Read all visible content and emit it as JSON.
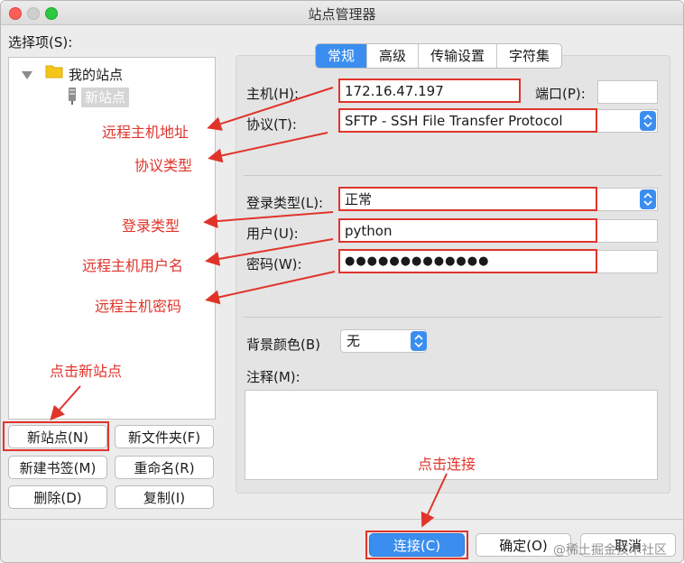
{
  "window": {
    "title": "站点管理器"
  },
  "colors": {
    "accent": "#3b8ef0",
    "annotation": "#e0342b",
    "close": "#fc5f57",
    "minimize": "#c9c9c9",
    "maximize": "#2bc840"
  },
  "left": {
    "heading": "选择项(S):",
    "tree": {
      "folder_label": "我的站点",
      "site_label": "新站点"
    },
    "buttons": {
      "new_site": "新站点(N)",
      "new_folder": "新文件夹(F)",
      "new_bookmark": "新建书签(M)",
      "rename": "重命名(R)",
      "delete": "删除(D)",
      "copy": "复制(I)"
    }
  },
  "tabs": [
    "常规",
    "高级",
    "传输设置",
    "字符集"
  ],
  "form": {
    "host_label": "主机(H):",
    "host_value": "172.16.47.197",
    "port_label": "端口(P):",
    "port_value": "",
    "protocol_label": "协议(T):",
    "protocol_value": "SFTP - SSH File Transfer Protocol",
    "logon_label": "登录类型(L):",
    "logon_value": "正常",
    "user_label": "用户(U):",
    "user_value": "python",
    "password_label": "密码(W):",
    "password_value": "●●●●●●●●●●●●●",
    "bg_label": "背景颜色(B)",
    "bg_value": "无",
    "comment_label": "注释(M):",
    "comment_value": ""
  },
  "annotations": {
    "host": "远程主机地址",
    "protocol": "协议类型",
    "logon": "登录类型",
    "user": "远程主机用户名",
    "password": "远程主机密码",
    "new_site": "点击新站点",
    "connect": "点击连接"
  },
  "footer": {
    "connect": "连接(C)",
    "ok": "确定(O)",
    "cancel": "取消"
  },
  "watermark": "@稀土掘金技术社区"
}
